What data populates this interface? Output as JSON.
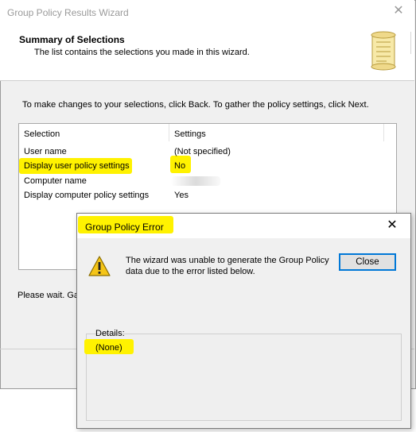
{
  "wizard": {
    "title": "Group Policy Results Wizard",
    "header_title": "Summary of Selections",
    "header_subtitle": "The list contains the selections you made in this wizard.",
    "instructions": "To make changes to your selections, click Back. To gather the policy settings, click Next.",
    "columns": [
      "Selection",
      "Settings"
    ],
    "rows": [
      {
        "selection": "User name",
        "setting": "(Not specified)"
      },
      {
        "selection": "Display user policy settings",
        "setting": "No"
      },
      {
        "selection": "Computer name",
        "setting": ""
      },
      {
        "selection": "Display computer policy settings",
        "setting": "Yes"
      }
    ],
    "status": "Please wait. Gat",
    "close_glyph": "✕"
  },
  "error_dialog": {
    "title": "Group Policy Error",
    "message": "The wizard was unable to generate the Group Policy data due to the error listed below.",
    "close_button": "Close",
    "details_label": "Details:",
    "details_value": "(None)",
    "close_glyph": "✕"
  },
  "colors": {
    "highlight": "#fff200",
    "accent": "#0078d7"
  },
  "icons": {
    "wizard_header": "scroll-icon",
    "error": "warning-icon"
  }
}
